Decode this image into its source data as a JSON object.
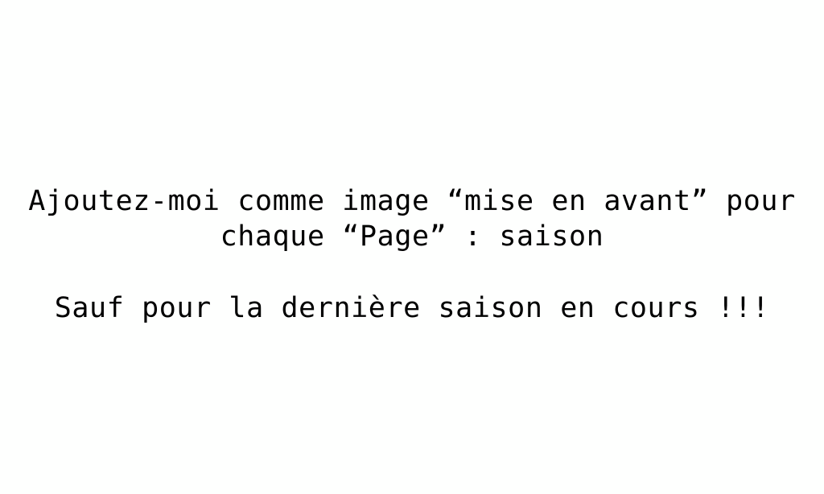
{
  "message": {
    "line_1": "Ajoutez-moi comme image “mise en avant” pour",
    "line_2": "chaque “Page” : saison",
    "line_3": "Sauf pour la dernière saison en cours !!!"
  },
  "colors": {
    "background": "#fefffe",
    "text": "#000000"
  }
}
